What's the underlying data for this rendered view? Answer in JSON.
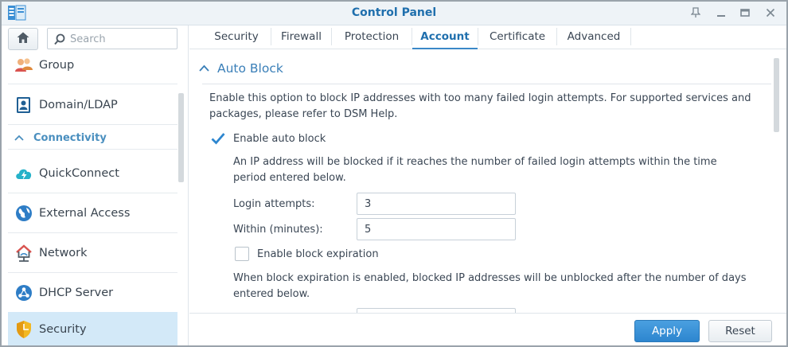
{
  "window": {
    "title": "Control Panel",
    "accent": "#1f6fad",
    "controls": [
      "pin",
      "minimize",
      "maximize",
      "close"
    ]
  },
  "sidebar": {
    "search_placeholder": "Search",
    "items": [
      {
        "label": "Group",
        "icon": "group-icon"
      },
      {
        "label": "Domain/LDAP",
        "icon": "domain-ldap-icon"
      },
      {
        "label": "QuickConnect",
        "icon": "quickconnect-icon"
      },
      {
        "label": "External Access",
        "icon": "external-access-icon"
      },
      {
        "label": "Network",
        "icon": "network-icon"
      },
      {
        "label": "DHCP Server",
        "icon": "dhcp-server-icon"
      },
      {
        "label": "Security",
        "icon": "security-shield-icon",
        "active": true
      }
    ],
    "section_connectivity": "Connectivity"
  },
  "tabs": [
    {
      "label": "Security"
    },
    {
      "label": "Firewall"
    },
    {
      "label": "Protection"
    },
    {
      "label": "Account",
      "active": true
    },
    {
      "label": "Certificate"
    },
    {
      "label": "Advanced"
    }
  ],
  "main": {
    "section_title": "Auto Block",
    "description": "Enable this option to block IP addresses with too many failed login attempts. For supported services and packages, please refer to DSM Help.",
    "enable_auto_block": {
      "label": "Enable auto block",
      "checked": true
    },
    "auto_block_note": "An IP address will be blocked if it reaches the number of failed login attempts within the time period entered below.",
    "login_attempts": {
      "label": "Login attempts:",
      "value": "3"
    },
    "within_minutes": {
      "label": "Within (minutes):",
      "value": "5"
    },
    "enable_block_expiration": {
      "label": "Enable block expiration",
      "checked": false
    },
    "expiration_note": "When block expiration is enabled, blocked IP addresses will be unblocked after the number of days entered below."
  },
  "footer": {
    "apply_label": "Apply",
    "reset_label": "Reset"
  },
  "colors": {
    "active_nav_bg": "#d3e9f8",
    "section_title": "#3a7fb8",
    "apply_button": "#2d86cf"
  }
}
